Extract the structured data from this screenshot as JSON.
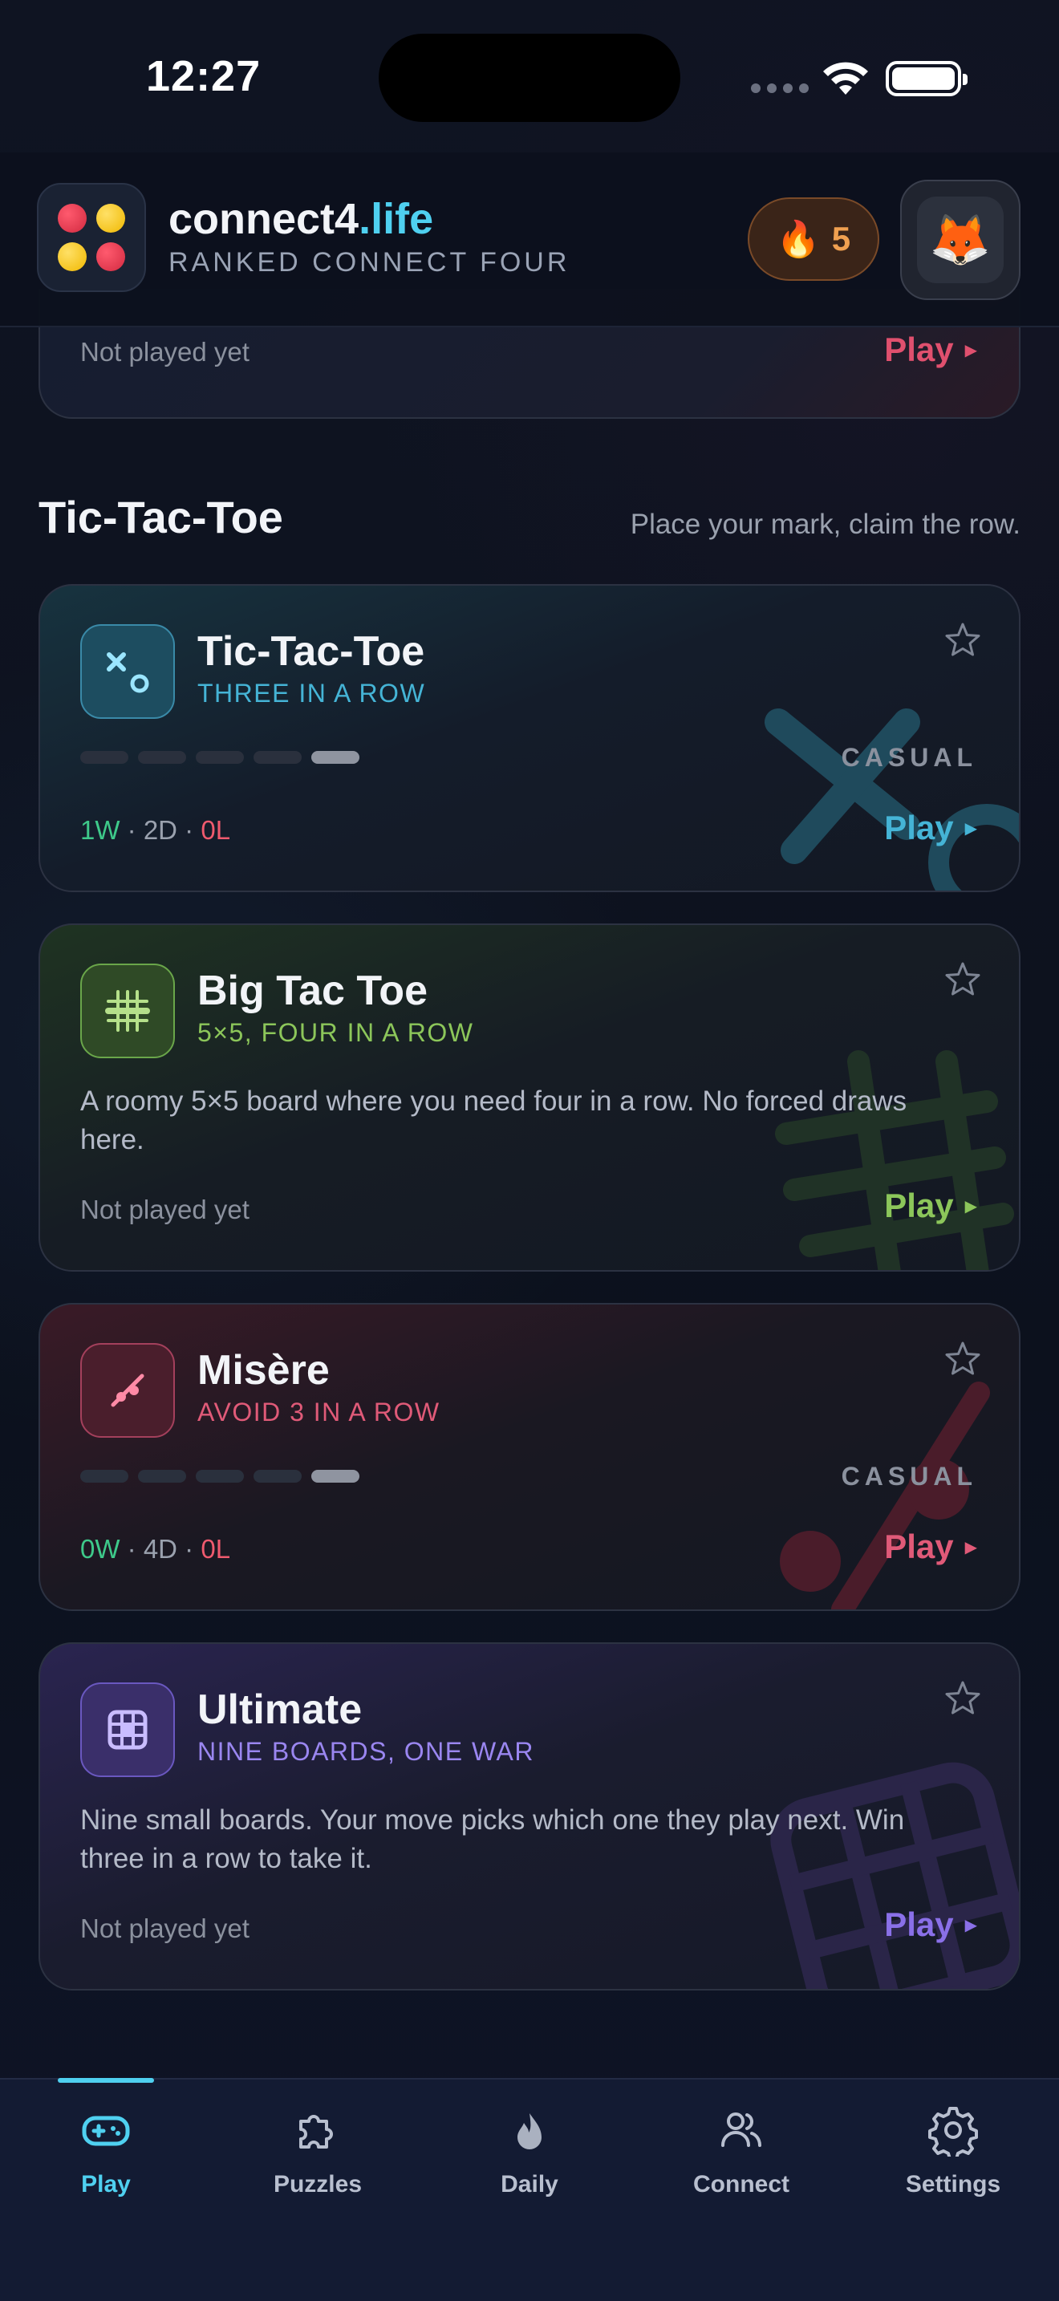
{
  "status": {
    "time": "12:27"
  },
  "header": {
    "brand_main": "connect4",
    "brand_accent": ".life",
    "subtitle": "RANKED CONNECT FOUR",
    "streak_count": "5",
    "streak_icon": "🔥",
    "avatar_icon": "🦊"
  },
  "previous_card": {
    "status": "Not played yet",
    "play_label": "Play"
  },
  "section": {
    "title": "Tic-Tac-Toe",
    "tagline": "Place your mark, claim the row."
  },
  "cards": [
    {
      "title": "Tic-Tac-Toe",
      "subtitle": "THREE IN A ROW",
      "accent": "#45b4d6",
      "tier": "CASUAL",
      "difficulty_level": 5,
      "difficulty_max": 5,
      "record": {
        "w": "1W",
        "d": "2D",
        "l": "0L"
      },
      "play_label": "Play",
      "icon": "tic-tac-toe-icon"
    },
    {
      "title": "Big Tac Toe",
      "subtitle": "5×5, FOUR IN A ROW",
      "accent": "#8cc65a",
      "description": "A roomy 5×5 board where you need four in a row. No forced draws here.",
      "status": "Not played yet",
      "play_label": "Play",
      "icon": "grid-hash-icon"
    },
    {
      "title": "Misère",
      "subtitle": "AVOID 3 IN A ROW",
      "accent": "#e05a78",
      "tier": "CASUAL",
      "difficulty_level": 5,
      "difficulty_max": 5,
      "record": {
        "w": "0W",
        "d": "4D",
        "l": "0L"
      },
      "play_label": "Play",
      "icon": "misere-icon"
    },
    {
      "title": "Ultimate",
      "subtitle": "NINE BOARDS, ONE WAR",
      "accent": "#9a86f0",
      "description": "Nine small boards. Your move picks which one they play next. Win three in a row to take it.",
      "status": "Not played yet",
      "play_label": "Play",
      "icon": "nine-grid-icon"
    }
  ],
  "tabs": [
    {
      "label": "Play",
      "icon": "gamepad-icon",
      "active": true
    },
    {
      "label": "Puzzles",
      "icon": "puzzle-icon",
      "active": false
    },
    {
      "label": "Daily",
      "icon": "flame-icon",
      "active": false
    },
    {
      "label": "Connect",
      "icon": "people-icon",
      "active": false
    },
    {
      "label": "Settings",
      "icon": "gear-icon",
      "active": false
    }
  ]
}
